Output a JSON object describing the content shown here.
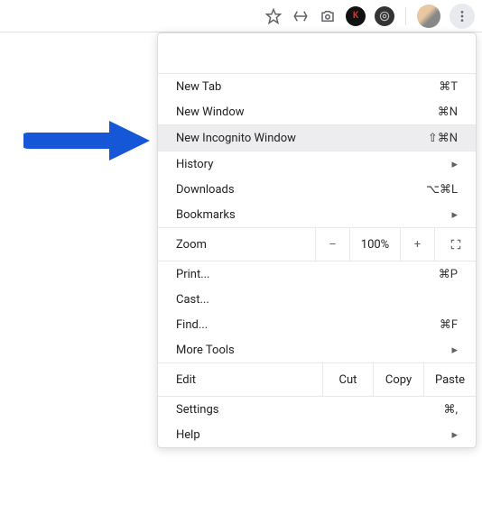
{
  "toolbar": {
    "star_icon": "star",
    "recycle_icon": "recycle",
    "camera_icon": "camera",
    "ext_k": "K",
    "ext_swirl": "◎",
    "more_icon": "more"
  },
  "menu": {
    "new_tab": {
      "label": "New Tab",
      "shortcut": "⌘T"
    },
    "new_window": {
      "label": "New Window",
      "shortcut": "⌘N"
    },
    "incognito": {
      "label": "New Incognito Window",
      "shortcut": "⇧⌘N"
    },
    "history": {
      "label": "History"
    },
    "downloads": {
      "label": "Downloads",
      "shortcut": "⌥⌘L"
    },
    "bookmarks": {
      "label": "Bookmarks"
    },
    "zoom": {
      "label": "Zoom",
      "value": "100%",
      "minus": "–",
      "plus": "+"
    },
    "print": {
      "label": "Print...",
      "shortcut": "⌘P"
    },
    "cast": {
      "label": "Cast..."
    },
    "find": {
      "label": "Find...",
      "shortcut": "⌘F"
    },
    "more_tools": {
      "label": "More Tools"
    },
    "edit": {
      "label": "Edit",
      "cut": "Cut",
      "copy": "Copy",
      "paste": "Paste"
    },
    "settings": {
      "label": "Settings",
      "shortcut": "⌘,"
    },
    "help": {
      "label": "Help"
    }
  }
}
